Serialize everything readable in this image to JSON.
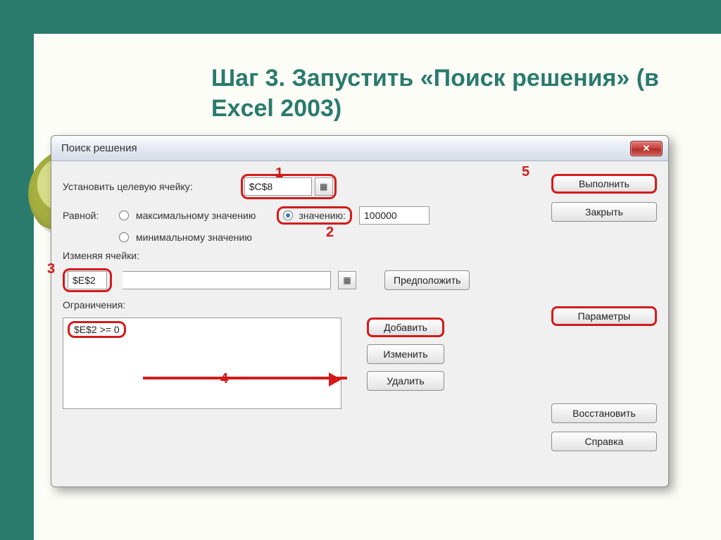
{
  "slide": {
    "title": "Шаг 3. Запустить  «Поиск решения» (в Excel 2003)"
  },
  "dialog": {
    "title": "Поиск решения",
    "close_tooltip": "Закрыть",
    "labels": {
      "target_cell": "Установить целевую ячейку:",
      "equal_to": "Равной:",
      "max": "максимальному значению",
      "min": "минимальному значению",
      "value": "значению:",
      "changing_cells": "Изменяя ячейки:",
      "constraints": "Ограничения:"
    },
    "inputs": {
      "target_cell": "$C$8",
      "value": "100000",
      "changing_cells": "$E$2",
      "constraints_list": "$E$2 >= 0"
    },
    "radio_selected": "value",
    "buttons": {
      "guess": "Предположить",
      "add": "Добавить",
      "change": "Изменить",
      "delete": "Удалить",
      "solve": "Выполнить",
      "close": "Закрыть",
      "options": "Параметры",
      "reset": "Восстановить",
      "help": "Справка"
    }
  },
  "markers": {
    "m1": "1",
    "m2": "2",
    "m3": "3",
    "m4": "4",
    "m5": "5"
  }
}
